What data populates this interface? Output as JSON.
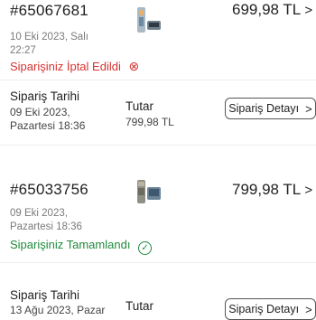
{
  "orders": [
    {
      "order_no": "#65067681",
      "amount": "699,98 TL",
      "date_line1": "10 Eki 2023, Salı",
      "date_line2": "22:27",
      "status": "Siparişiniz İptal Edildi",
      "status_icon": "cancel-icon",
      "status_color": "#d6332f"
    },
    {
      "order_date_label": "Sipariş Tarihi",
      "order_date_line1": "09 Eki 2023,",
      "order_date_line2": "Pazartesi 18:36",
      "total_label": "Tutar",
      "total_value": "799,98 TL",
      "detail_button": "Sipariş Detayı",
      "order_no": "#65033756",
      "amount": "799,98 TL",
      "date_line1": "09 Eki 2023,",
      "date_line2": "Pazartesi 18:36",
      "status": "Siparişiniz Tamamlandı",
      "status_icon": "check-circle-icon",
      "status_color": "#1f8a3c"
    },
    {
      "order_date_label": "Sipariş Tarihi",
      "order_date_line1": "13 Ağu 2023, Pazar",
      "total_label": "Tutar",
      "detail_button": "Sipariş Detayı"
    }
  ],
  "icons": {
    "cancel": "⊗",
    "check": "✓",
    "chevron": "›",
    "chevron_large": ">"
  }
}
